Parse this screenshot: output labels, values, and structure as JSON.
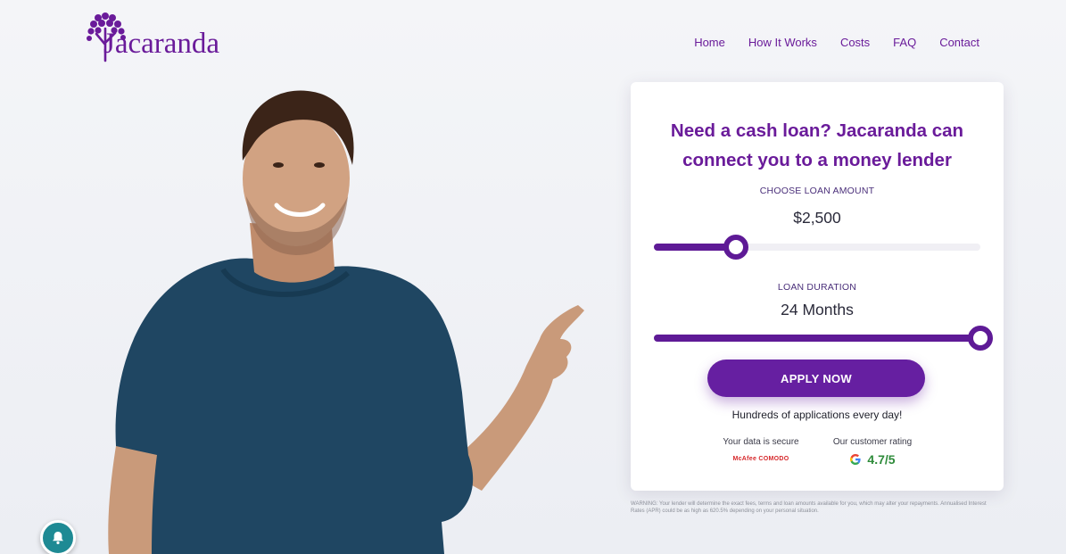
{
  "brand": {
    "name": "Jacaranda",
    "color": "#6a1b9a"
  },
  "nav": {
    "items": [
      {
        "label": "Home"
      },
      {
        "label": "How It Works"
      },
      {
        "label": "Costs"
      },
      {
        "label": "FAQ"
      },
      {
        "label": "Contact"
      }
    ]
  },
  "card": {
    "title_line1": "Need a cash loan? Jacaranda can",
    "title_line2": "connect you to a money lender",
    "amount": {
      "label": "CHOOSE LOAN AMOUNT",
      "value": "$2,500",
      "fill_fraction": 0.25
    },
    "duration": {
      "label": "LOAN DURATION",
      "value": "24 Months",
      "fill_fraction": 1.0
    },
    "apply_label": "APPLY NOW",
    "tagline": "Hundreds of applications every day!",
    "secure": {
      "label": "Your data is secure",
      "badges": "McAfee  COMODO"
    },
    "rating": {
      "label": "Our customer rating",
      "value": "4.7/5",
      "icon": "google-icon"
    }
  },
  "warning": "WARNING: Your lender will determine the exact fees, terms and loan amounts available for you, which may alter your repayments. Annualised Interest Rates (APR) could be as high as 620.5% depending on your personal situation.",
  "colors": {
    "accent": "#661fa1",
    "rating": "#2e8b3a",
    "bell": "#1e8a94"
  }
}
